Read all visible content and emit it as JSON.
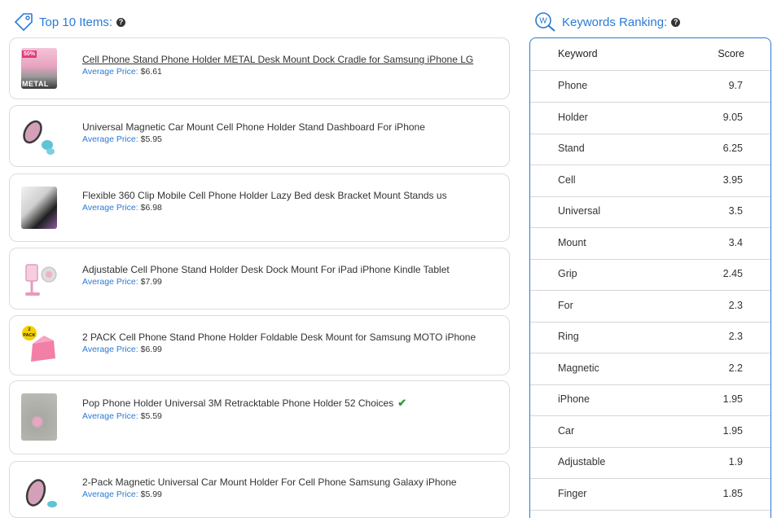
{
  "items_section": {
    "title": "Top 10 Items:",
    "help": "?",
    "price_label": "Average Price:",
    "items": [
      {
        "title": "Cell Phone Stand Phone Holder METAL Desk Mount Dock Cradle for Samsung iPhone LG",
        "price": "$6.61",
        "thumb_badge": "50%",
        "thumb_text": "METAL"
      },
      {
        "title": "Universal Magnetic Car Mount Cell Phone Holder Stand Dashboard For iPhone",
        "price": "$5.95"
      },
      {
        "title": "Flexible 360 Clip Mobile Cell Phone Holder Lazy Bed desk Bracket Mount Stands us",
        "price": "$6.98"
      },
      {
        "title": "Adjustable Cell Phone Stand Holder Desk Dock Mount For iPad iPhone Kindle Tablet",
        "price": "$7.99"
      },
      {
        "title": "2 PACK Cell Phone Stand Phone Holder Foldable Desk Mount for Samsung MOTO iPhone",
        "price": "$6.99",
        "thumb_badge": "2 PACK"
      },
      {
        "title": "Pop Phone Holder Universal 3M Retracktable Phone Holder 52 Choices",
        "price": "$5.59"
      },
      {
        "title": "2-Pack Magnetic Universal Car Mount Holder For Cell Phone Samsung Galaxy iPhone",
        "price": "$5.99"
      }
    ]
  },
  "keywords_section": {
    "title": "Keywords Ranking:",
    "help": "?",
    "icon_letter": "W",
    "col_keyword": "Keyword",
    "col_score": "Score",
    "rows": [
      {
        "keyword": "Phone",
        "score": "9.7"
      },
      {
        "keyword": "Holder",
        "score": "9.05"
      },
      {
        "keyword": "Stand",
        "score": "6.25"
      },
      {
        "keyword": "Cell",
        "score": "3.95"
      },
      {
        "keyword": "Universal",
        "score": "3.5"
      },
      {
        "keyword": "Mount",
        "score": "3.4"
      },
      {
        "keyword": "Grip",
        "score": "2.45"
      },
      {
        "keyword": "For",
        "score": "2.3"
      },
      {
        "keyword": "Ring",
        "score": "2.3"
      },
      {
        "keyword": "Magnetic",
        "score": "2.2"
      },
      {
        "keyword": "iPhone",
        "score": "1.95"
      },
      {
        "keyword": "Car",
        "score": "1.95"
      },
      {
        "keyword": "Adjustable",
        "score": "1.9"
      },
      {
        "keyword": "Finger",
        "score": "1.85"
      }
    ]
  },
  "colors": {
    "accent": "#2a7ad6",
    "check": "#2e9a3a",
    "border": "#dcdcdc"
  }
}
